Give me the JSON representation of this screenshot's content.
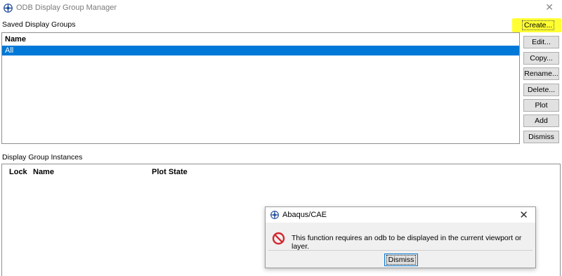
{
  "window": {
    "title": "ODB Display Group Manager",
    "icon": "abaqus-logo-icon",
    "close_glyph": "✕"
  },
  "saved_groups": {
    "label": "Saved Display Groups",
    "column": "Name",
    "rows": [
      "All"
    ],
    "selected_index": 0
  },
  "buttons": {
    "create": "Create...",
    "edit": "Edit...",
    "copy": "Copy...",
    "rename": "Rename...",
    "delete": "Delete...",
    "plot": "Plot",
    "add": "Add",
    "dismiss": "Dismiss"
  },
  "instances": {
    "label": "Display Group Instances",
    "columns": {
      "lock": "Lock",
      "name": "Name",
      "plot_state": "Plot State"
    }
  },
  "dialog": {
    "title": "Abaqus/CAE",
    "icon": "error-icon",
    "message": "This function requires an odb to be displayed in the current viewport or layer.",
    "button": "Dismiss",
    "close_glyph": "✕"
  },
  "colors": {
    "selection": "#0078d7",
    "highlight": "#ffff33",
    "error": "#d3272f"
  }
}
